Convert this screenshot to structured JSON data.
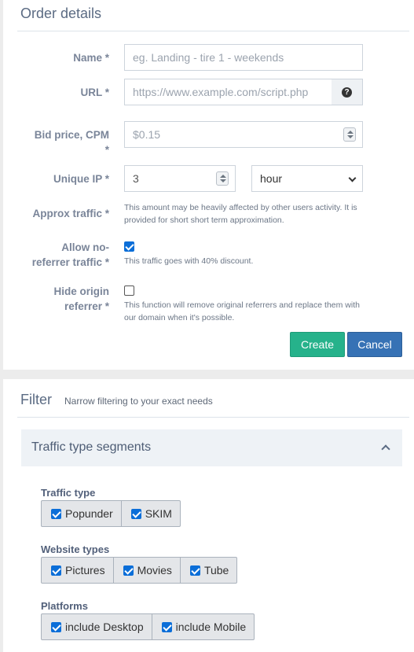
{
  "order": {
    "title": "Order details",
    "name": {
      "label": "Name *",
      "placeholder": "eg. Landing - tire 1 - weekends"
    },
    "url": {
      "label": "URL *",
      "placeholder": "https://www.example.com/script.php",
      "help_icon": "question-circle-icon"
    },
    "bid": {
      "label_line1": "Bid price, CPM",
      "label_line2": "*",
      "placeholder": "$0.15"
    },
    "unique_ip": {
      "label": "Unique IP *",
      "value": "3",
      "period": "hour"
    },
    "approx": {
      "label": "Approx traffic *",
      "help": "This amount may be heavily affected by other users activity. It is provided for short short term approximation."
    },
    "noref": {
      "label_line1": "Allow no-",
      "label_line2": "referrer traffic *",
      "checked": true,
      "help": "This traffic goes with 40% discount."
    },
    "hide": {
      "label_line1": "Hide origin",
      "label_line2": "referrer *",
      "checked": false,
      "help": "This function will remove original referrers and replace them with our domain when it's possible."
    },
    "create_label": "Create",
    "cancel_label": "Cancel"
  },
  "filter": {
    "title": "Filter",
    "subtitle": "Narrow filtering to your exact needs",
    "segment_title": "Traffic type segments",
    "groups": [
      {
        "label": "Traffic type",
        "options": [
          {
            "label": "Popunder",
            "checked": true
          },
          {
            "label": "SKIM",
            "checked": true
          }
        ]
      },
      {
        "label": "Website types",
        "options": [
          {
            "label": "Pictures",
            "checked": true
          },
          {
            "label": "Movies",
            "checked": true
          },
          {
            "label": "Tube",
            "checked": true
          }
        ]
      },
      {
        "label": "Platforms",
        "options": [
          {
            "label": "include Desktop",
            "checked": true
          },
          {
            "label": "include Mobile",
            "checked": true
          }
        ]
      }
    ]
  },
  "colors": {
    "create": "#26b28b",
    "cancel": "#3772b5",
    "checkbox": "#0b6ed8"
  }
}
